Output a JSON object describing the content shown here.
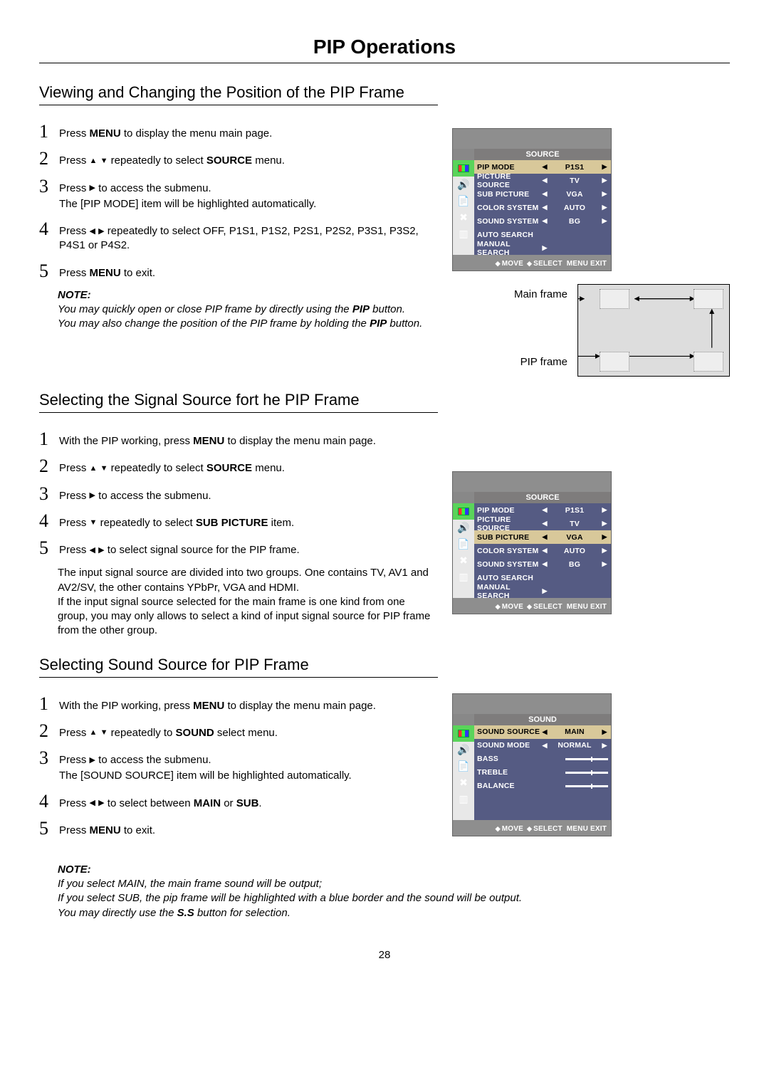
{
  "page_title": "PIP Operations",
  "page_number": "28",
  "sections": [
    {
      "title": "Viewing and Changing the Position of the PIP Frame",
      "steps": [
        {
          "n": "1",
          "text_pre": "Press",
          "bold1": " MENU",
          "text_post": " to display the menu main page."
        },
        {
          "n": "2",
          "line": {
            "pre": "Press",
            "icons": "updown",
            "mid": " repeatedly to select",
            "bold": " SOURCE",
            "post": " menu."
          }
        },
        {
          "n": "3",
          "line": {
            "pre": "Press",
            "icons": "right",
            "post": " to access the submenu."
          },
          "sub": "The [PIP MODE] item will be highlighted automatically."
        },
        {
          "n": "4",
          "line": {
            "pre": "Press",
            "icons": "leftright",
            "post": " repeatedly to select OFF, P1S1, P1S2, P2S1, P2S2, P3S1, P3S2, P4S1 or P4S2."
          }
        },
        {
          "n": "5",
          "text_pre": "Press",
          "bold1": " MENU",
          "text_post": " to exit."
        }
      ],
      "note": {
        "label": "NOTE:",
        "lines": [
          {
            "pre": "You may quickly open or close PIP frame by directly using the ",
            "bold": "PIP",
            "post": " button."
          },
          {
            "pre": "You may also change the position of the PIP frame by holding the ",
            "bold": "PIP",
            "post": " button."
          }
        ]
      },
      "osd": {
        "title": "SOURCE",
        "highlighted_index": 0,
        "rows": [
          {
            "label": "PIP MODE",
            "value": "P1S1",
            "arrows": true
          },
          {
            "label": "PICTURE SOURCE",
            "value": "TV",
            "arrows": true
          },
          {
            "label": "SUB PICTURE",
            "value": "VGA",
            "arrows": true
          },
          {
            "label": "COLOR SYSTEM",
            "value": "AUTO",
            "arrows": true
          },
          {
            "label": "SOUND SYSTEM",
            "value": "BG",
            "arrows": true
          },
          {
            "label": "AUTO SEARCH"
          },
          {
            "label": "MANUAL SEARCH",
            "value": "",
            "rightonly": true
          }
        ],
        "footer": {
          "move": "MOVE",
          "select": "SELECT",
          "exit": "MENU EXIT"
        }
      },
      "diagram": {
        "main_label": "Main frame",
        "pip_label": "PIP frame"
      }
    },
    {
      "title": "Selecting the Signal Source fort he PIP Frame",
      "steps": [
        {
          "n": "1",
          "text_pre": "With the PIP working, press",
          "bold1": " MENU",
          "text_post": " to display the menu main page."
        },
        {
          "n": "2",
          "line": {
            "pre": "Press",
            "icons": "updown",
            "mid": " repeatedly to select",
            "bold": " SOURCE",
            "post": " menu."
          }
        },
        {
          "n": "3",
          "line": {
            "pre": "Press",
            "icons": "right",
            "post": " to access the submenu."
          }
        },
        {
          "n": "4",
          "line": {
            "pre": "Press",
            "icons": "down",
            "mid": " repeatedly to select",
            "bold": " SUB PICTURE",
            "post": " item."
          }
        },
        {
          "n": "5",
          "line": {
            "pre": "Press",
            "icons": "leftright",
            "post": " to select signal source for the PIP frame."
          }
        }
      ],
      "body": "The input signal source are divided into two groups. One contains TV, AV1 and AV2/SV, the other contains YPbPr, VGA and HDMI.\nIf the input signal source selected for the main frame is one kind from one group, you may only allows to select a kind of input signal source for PIP frame from the other group.",
      "osd": {
        "title": "SOURCE",
        "highlighted_index": 2,
        "rows": [
          {
            "label": "PIP MODE",
            "value": "P1S1",
            "arrows": true
          },
          {
            "label": "PICTURE SOURCE",
            "value": "TV",
            "arrows": true
          },
          {
            "label": "SUB PICTURE",
            "value": "VGA",
            "arrows": true
          },
          {
            "label": "COLOR SYSTEM",
            "value": "AUTO",
            "arrows": true
          },
          {
            "label": "SOUND SYSTEM",
            "value": "BG",
            "arrows": true
          },
          {
            "label": "AUTO SEARCH"
          },
          {
            "label": "MANUAL SEARCH",
            "value": "",
            "rightonly": true
          }
        ],
        "footer": {
          "move": "MOVE",
          "select": "SELECT",
          "exit": "MENU EXIT"
        }
      }
    },
    {
      "title": "Selecting Sound Source for PIP Frame",
      "steps": [
        {
          "n": "1",
          "text_pre": "With the PIP working, press",
          "bold1": " MENU",
          "text_post": " to display the menu main page."
        },
        {
          "n": "2",
          "line": {
            "pre": "Press",
            "icons": "updown",
            "mid": " repeatedly to",
            "bold": " SOUND",
            "post": " select menu."
          }
        },
        {
          "n": "3",
          "line": {
            "pre": "Press",
            "icons": "right",
            "post": " to access the submenu."
          },
          "sub": "The [SOUND SOURCE] item will be highlighted automatically."
        },
        {
          "n": "4",
          "line": {
            "pre": "Press",
            "icons": "leftright",
            "mid": " to select between",
            "bold": " MAIN",
            "mid2": " or",
            "bold2": " SUB",
            "post": "."
          }
        },
        {
          "n": "5",
          "text_pre": "Press",
          "bold1": " MENU",
          "text_post": " to exit."
        }
      ],
      "note": {
        "label": "NOTE:",
        "lines": [
          {
            "pre": "If you select MAIN, the main frame sound will be output;"
          },
          {
            "pre": "If you select SUB, the pip frame will be highlighted with a blue border and the sound will be output."
          },
          {
            "pre": "You may directly use the ",
            "bold": "S.S",
            "post": " button for selection."
          }
        ]
      },
      "osd": {
        "title": "SOUND",
        "highlighted_index": 0,
        "rows": [
          {
            "label": "SOUND SOURCE",
            "value": "MAIN",
            "arrows": true
          },
          {
            "label": "SOUND MODE",
            "value": "NORMAL",
            "arrows": true
          },
          {
            "label": "BASS",
            "slider": true
          },
          {
            "label": "TREBLE",
            "slider": true
          },
          {
            "label": "BALANCE",
            "slider": true
          }
        ],
        "footer": {
          "move": "MOVE",
          "select": "SELECT",
          "exit": "MENU EXIT"
        }
      }
    }
  ]
}
